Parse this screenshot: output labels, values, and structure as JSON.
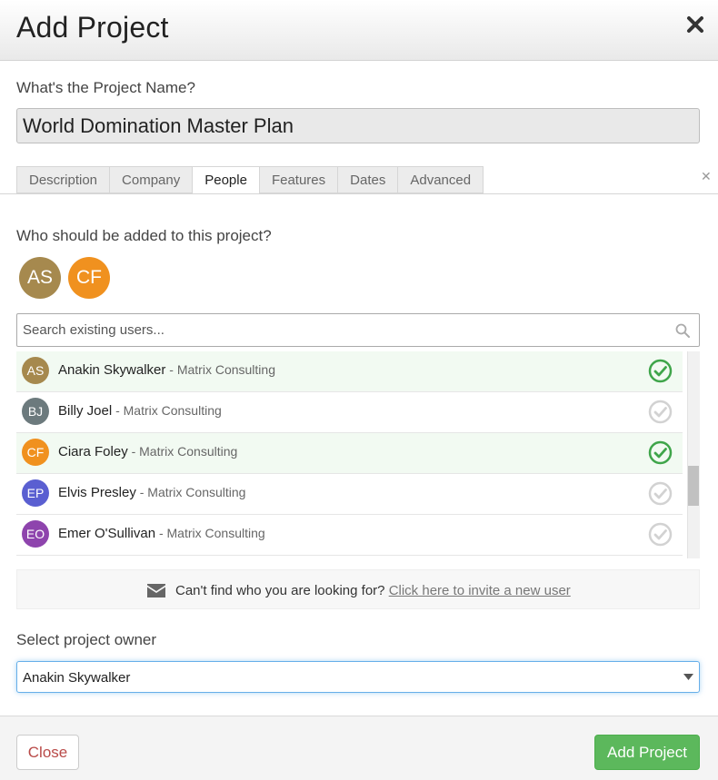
{
  "dialog": {
    "title": "Add Project"
  },
  "project_name": {
    "label": "What's the Project Name?",
    "value": "World Domination Master Plan"
  },
  "tabs": [
    {
      "label": "Description",
      "active": false
    },
    {
      "label": "Company",
      "active": false
    },
    {
      "label": "People",
      "active": true
    },
    {
      "label": "Features",
      "active": false
    },
    {
      "label": "Dates",
      "active": false
    },
    {
      "label": "Advanced",
      "active": false
    }
  ],
  "people": {
    "heading": "Who should be added to this project?",
    "selected": [
      {
        "initials": "AS",
        "color": "#a6894e"
      },
      {
        "initials": "CF",
        "color": "#f0911f"
      }
    ],
    "search_placeholder": "Search existing users...",
    "users": [
      {
        "initials": "AS",
        "color": "#a6894e",
        "name": "Anakin Skywalker",
        "company": " - Matrix Consulting",
        "selected": true
      },
      {
        "initials": "BJ",
        "color": "#6c7a7d",
        "name": "Billy Joel",
        "company": " - Matrix Consulting",
        "selected": false
      },
      {
        "initials": "CF",
        "color": "#f0911f",
        "name": "Ciara Foley",
        "company": " - Matrix Consulting",
        "selected": true
      },
      {
        "initials": "EP",
        "color": "#5a5fd1",
        "name": "Elvis Presley",
        "company": " - Matrix Consulting",
        "selected": false
      },
      {
        "initials": "EO",
        "color": "#8e44ad",
        "name": "Emer O'Sullivan",
        "company": " - Matrix Consulting",
        "selected": false
      }
    ],
    "invite_text": "Can't find who you are looking for?",
    "invite_link": "Click here to invite a new user"
  },
  "owner": {
    "label": "Select project owner",
    "value": "Anakin Skywalker"
  },
  "footer": {
    "close_label": "Close",
    "add_label": "Add Project"
  },
  "colors": {
    "check_selected": "#3fa54a",
    "check_unselected": "#d2d2d2",
    "primary_button": "#5cb85c",
    "close_text": "#b94a48"
  }
}
